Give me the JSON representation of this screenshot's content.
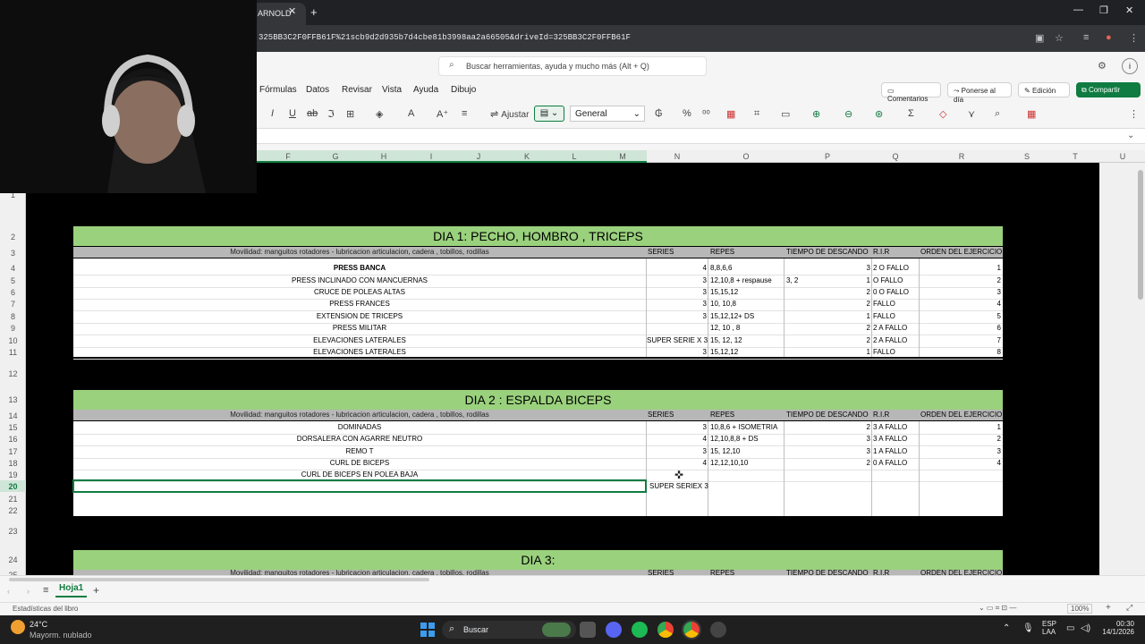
{
  "browser": {
    "tab_title": "ARNOLD",
    "tab_close": "✕",
    "new_tab": "+",
    "url": "325BB3C2F0FFB61F%21scb9d2d935b7d4cbe81b3998aa2a66505&driveId=325BB3C2F0FFB61F",
    "window_controls": [
      "—",
      "❐",
      "✕"
    ]
  },
  "excel": {
    "search_placeholder": "Buscar herramientas, ayuda y mucho más (Alt + Q)",
    "menu": [
      "Fórmulas",
      "Datos",
      "Revisar",
      "Vista",
      "Ayuda",
      "Dibujo"
    ],
    "comments_label": "Comentarios",
    "catchup_label": "Ponerse al día",
    "edit_label": "Edición",
    "share_label": "Compartir",
    "wrap_label": "Ajustar",
    "number_format": "General",
    "columns": [
      "F",
      "G",
      "H",
      "I",
      "J",
      "K",
      "L",
      "M",
      "N",
      "O",
      "P",
      "Q",
      "R",
      "S",
      "T",
      "U"
    ],
    "rows": [
      "1",
      "2",
      "3",
      "4",
      "5",
      "6",
      "7",
      "8",
      "9",
      "10",
      "11",
      "12",
      "13",
      "14",
      "15",
      "16",
      "17",
      "18",
      "19",
      "20",
      "21",
      "22",
      "23",
      "24",
      "25"
    ],
    "zoom": "100%"
  },
  "day1": {
    "title": "DIA 1: PECHO, HOMBRO , TRICEPS",
    "mobility": "Movilidad: manguitos rotadores - lubricacion articulacion, cadera , tobillos, rodillas",
    "headers": [
      "SERIES",
      "REPES",
      "TIEMPO DE DESCANDO",
      "R.I.R",
      "ORDEN DEL EJERCICIO"
    ],
    "exercises": [
      {
        "name": "PRESS BANCA",
        "series": "4",
        "repes": "8,8,6,6",
        "desc_note": "",
        "desc": "3",
        "rir": "2 O FALLO",
        "order": "1"
      },
      {
        "name": "PRESS INCLINADO CON MANCUERNAS",
        "series": "3",
        "repes": "12,10,8 + respause",
        "desc_note": "3, 2",
        "desc": "1",
        "rir": "O FALLO",
        "order": "2"
      },
      {
        "name": "CRUCE DE POLEAS ALTAS",
        "series": "3",
        "repes": "15,15,12",
        "desc_note": "",
        "desc": "2",
        "rir": "0 O FALLO",
        "order": "3"
      },
      {
        "name": "PRESS FRANCES",
        "series": "3",
        "repes": "10, 10,8",
        "desc_note": "",
        "desc": "2",
        "rir": "FALLO",
        "order": "4"
      },
      {
        "name": "EXTENSION DE TRICEPS",
        "series": "3",
        "repes": "15,12,12+ DS",
        "desc_note": "",
        "desc": "1",
        "rir": "FALLO",
        "order": "5"
      },
      {
        "name": "PRESS MILITAR",
        "series": "",
        "repes": "12, 10 , 8",
        "desc_note": "",
        "desc": "2",
        "rir": "2 A FALLO",
        "order": "6"
      },
      {
        "name": "ELEVACIONES LATERALES",
        "series": "SUPER SERIE X 3",
        "repes": "15, 12, 12",
        "desc_note": "",
        "desc": "2",
        "rir": "2 A FALLO",
        "order": "7"
      },
      {
        "name": "ELEVACIONES LATERALES",
        "series": "3",
        "repes": "15,12,12",
        "desc_note": "",
        "desc": "1",
        "rir": "FALLO",
        "order": "8"
      }
    ]
  },
  "day2": {
    "title": "DIA 2 : ESPALDA BICEPS",
    "mobility": "Movilidad: manguitos rotadores - lubricacion articulacion, cadera , tobillos, rodillas",
    "headers": [
      "SERIES",
      "REPES",
      "TIEMPO DE DESCANDO",
      "R.I.R",
      "ORDEN DEL EJERCICIO"
    ],
    "exercises": [
      {
        "name": "DOMINADAS",
        "series": "3",
        "repes": "10,8,6 + ISOMETRIA",
        "desc": "2",
        "rir": "3 A FALLO",
        "order": "1"
      },
      {
        "name": "DORSALERA CON AGARRE NEUTRO",
        "series": "4",
        "repes": "12,10,8,8 + DS",
        "desc": "3",
        "rir": "3 A FALLO",
        "order": "2"
      },
      {
        "name": "REMO T",
        "series": "3",
        "repes": "15, 12,10",
        "desc": "3",
        "rir": "1 A FALLO",
        "order": "3"
      },
      {
        "name": "CURL DE BICEPS",
        "series": "4",
        "repes": "12,12,10,10",
        "desc": "2",
        "rir": "0 A FALLO",
        "order": "4"
      },
      {
        "name": "CURL DE BICEPS EN POLEA BAJA",
        "series": "",
        "repes": "",
        "desc": "",
        "rir": "",
        "order": ""
      }
    ],
    "active_series": "SUPER SERIEX 3"
  },
  "day3": {
    "title": "DIA 3:",
    "mobility": "Movilidad: manguitos rotadores - lubricacion articulacion, cadera , tobillos, rodillas",
    "headers": [
      "SERIES",
      "REPES",
      "TIEMPO DE DESCANDO",
      "R.I.R",
      "ORDEN DEL EJERCICIO"
    ]
  },
  "sheet": {
    "tab": "Hoja1",
    "add": "+",
    "status": "Estadísticas del libro"
  },
  "taskbar": {
    "weather_temp": "24°C",
    "weather_desc": "Mayorm. nublado",
    "search": "Buscar",
    "lang1": "ESP",
    "lang2": "LAA",
    "time": "00:30",
    "date": "14/1/2026"
  }
}
